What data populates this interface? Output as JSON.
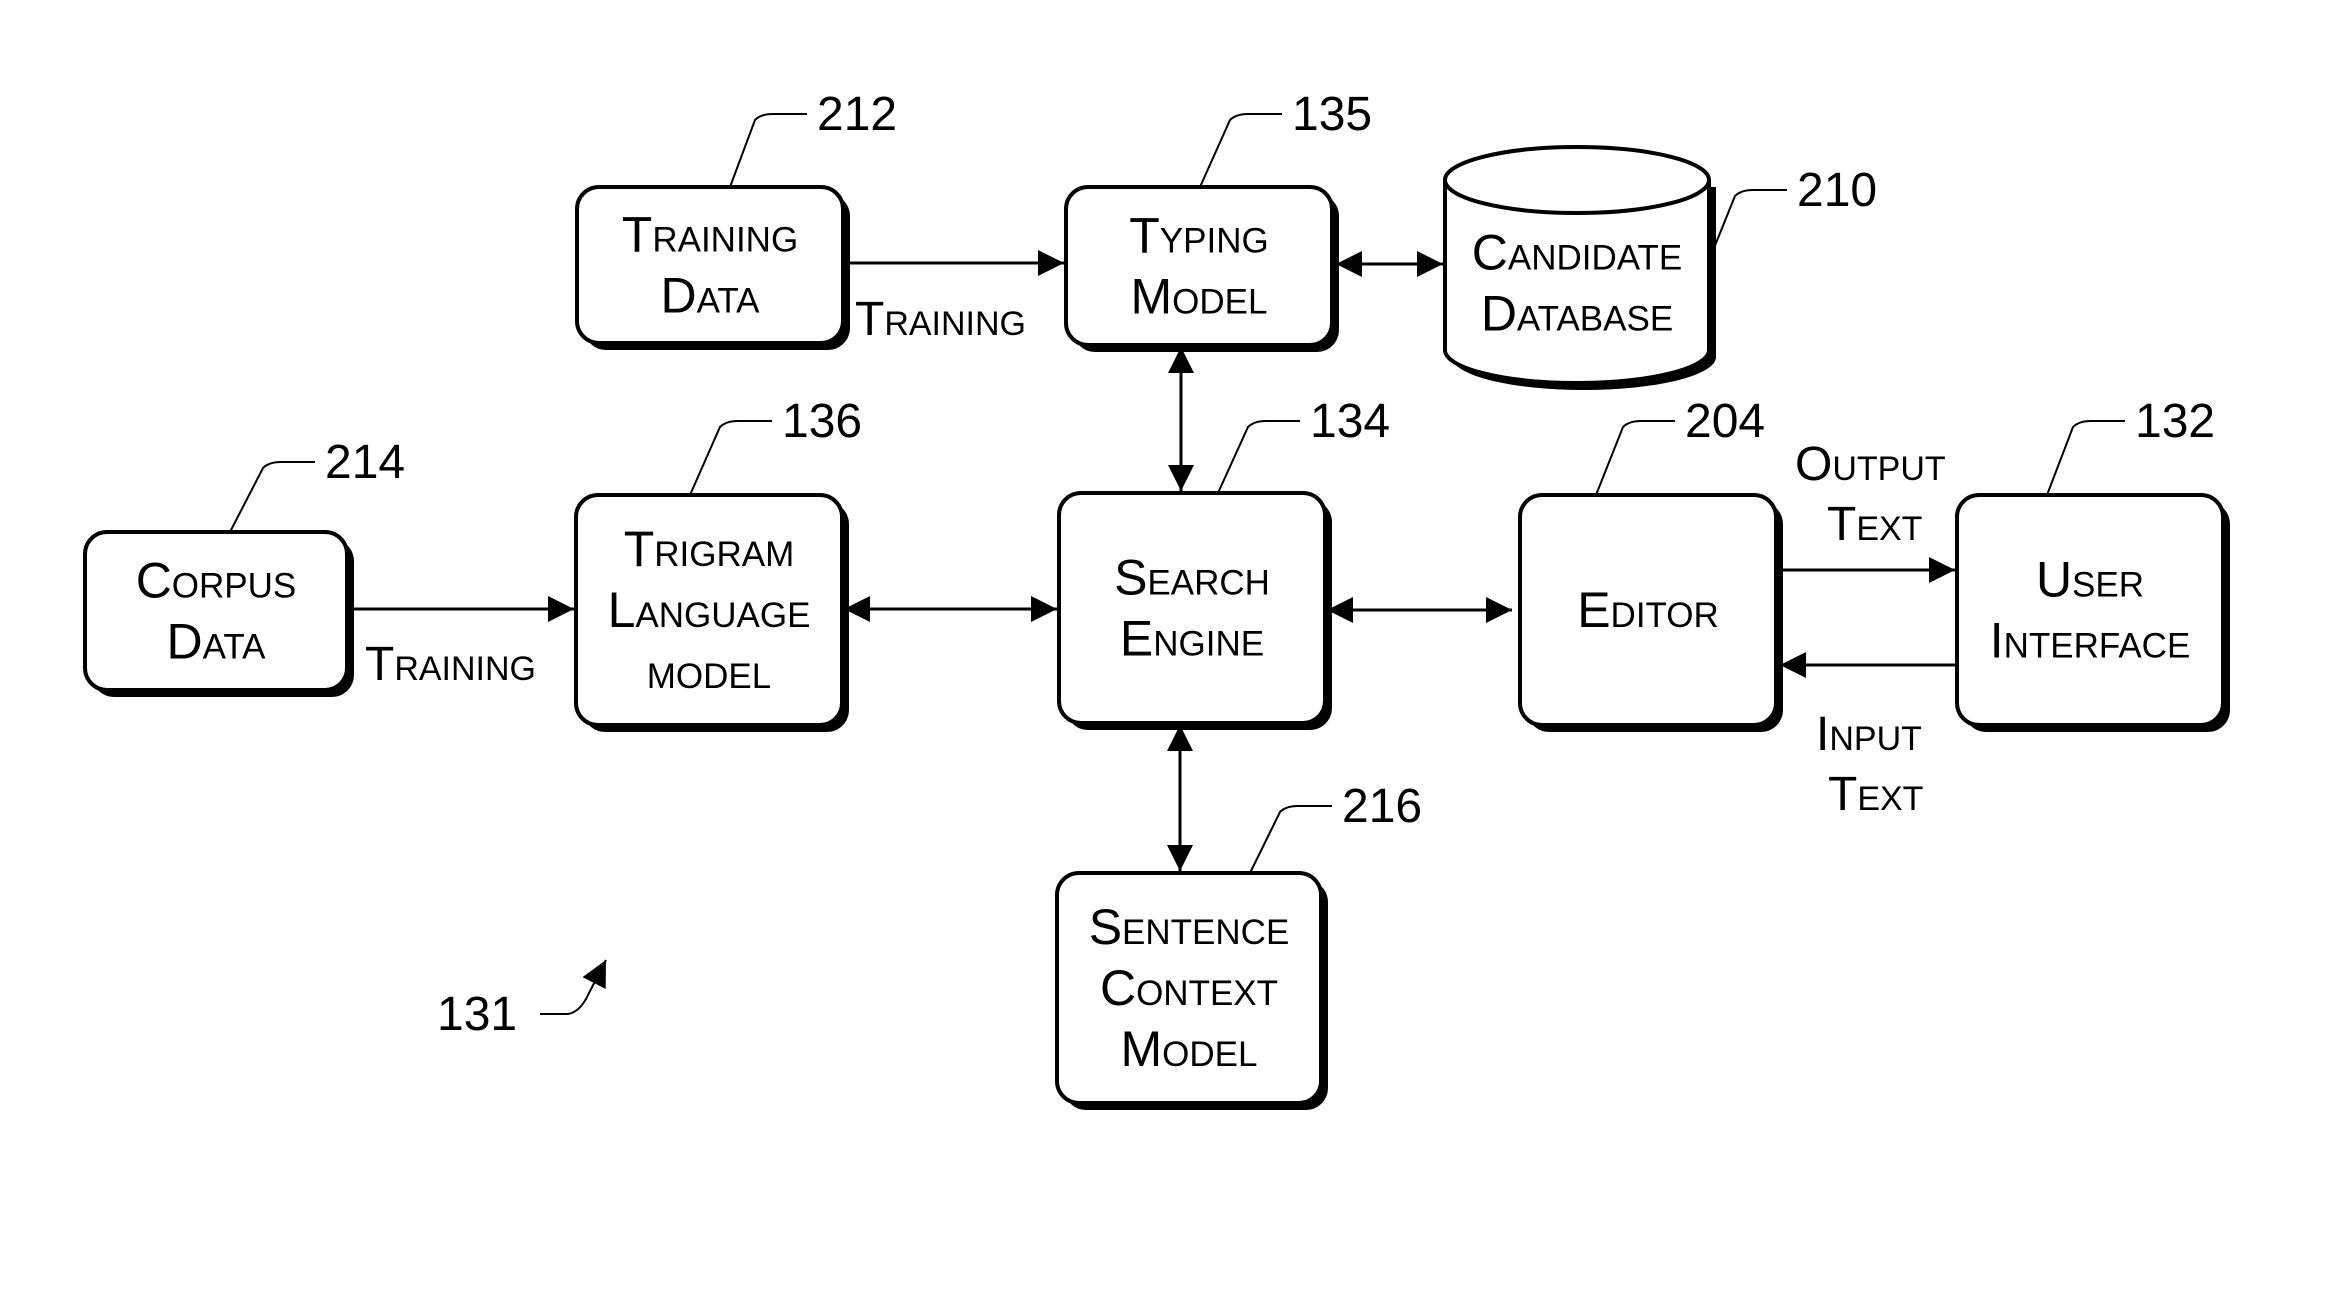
{
  "diagram": {
    "figure_ref": "131",
    "colors": {
      "ink": "#000000",
      "background": "#ffffff"
    },
    "nodes": [
      {
        "id": "corpus",
        "shape": "box",
        "ref": "214",
        "lines": [
          "Corpus",
          "Data"
        ]
      },
      {
        "id": "training_data",
        "shape": "box",
        "ref": "212",
        "lines": [
          "Training",
          "Data"
        ]
      },
      {
        "id": "trigram",
        "shape": "box",
        "ref": "136",
        "lines": [
          "Trigram",
          "Language",
          "model"
        ]
      },
      {
        "id": "typing",
        "shape": "box",
        "ref": "135",
        "lines": [
          "Typing",
          "Model"
        ]
      },
      {
        "id": "candidate_db",
        "shape": "cylinder",
        "ref": "210",
        "lines": [
          "Candidate",
          "Database"
        ]
      },
      {
        "id": "search",
        "shape": "box",
        "ref": "134",
        "lines": [
          "Search",
          "Engine"
        ]
      },
      {
        "id": "sentence",
        "shape": "box",
        "ref": "216",
        "lines": [
          "Sentence",
          "Context",
          "Model"
        ]
      },
      {
        "id": "editor",
        "shape": "box",
        "ref": "204",
        "lines": [
          "Editor"
        ]
      },
      {
        "id": "ui",
        "shape": "box",
        "ref": "132",
        "lines": [
          "User",
          "Interface"
        ]
      }
    ],
    "edges": [
      {
        "from": "training_data",
        "to": "typing",
        "direction": "forward",
        "label": [
          "Training"
        ]
      },
      {
        "from": "corpus",
        "to": "trigram",
        "direction": "forward",
        "label": [
          "Training"
        ]
      },
      {
        "from": "typing",
        "to": "candidate_db",
        "direction": "both",
        "label": []
      },
      {
        "from": "typing",
        "to": "search",
        "direction": "both",
        "label": []
      },
      {
        "from": "trigram",
        "to": "search",
        "direction": "both",
        "label": []
      },
      {
        "from": "search",
        "to": "editor",
        "direction": "both",
        "label": []
      },
      {
        "from": "search",
        "to": "sentence",
        "direction": "both",
        "label": []
      },
      {
        "from": "editor",
        "to": "ui",
        "direction": "forward",
        "label": [
          "Output",
          "Text"
        ]
      },
      {
        "from": "ui",
        "to": "editor",
        "direction": "forward",
        "label": [
          "Input",
          "Text"
        ]
      }
    ]
  }
}
